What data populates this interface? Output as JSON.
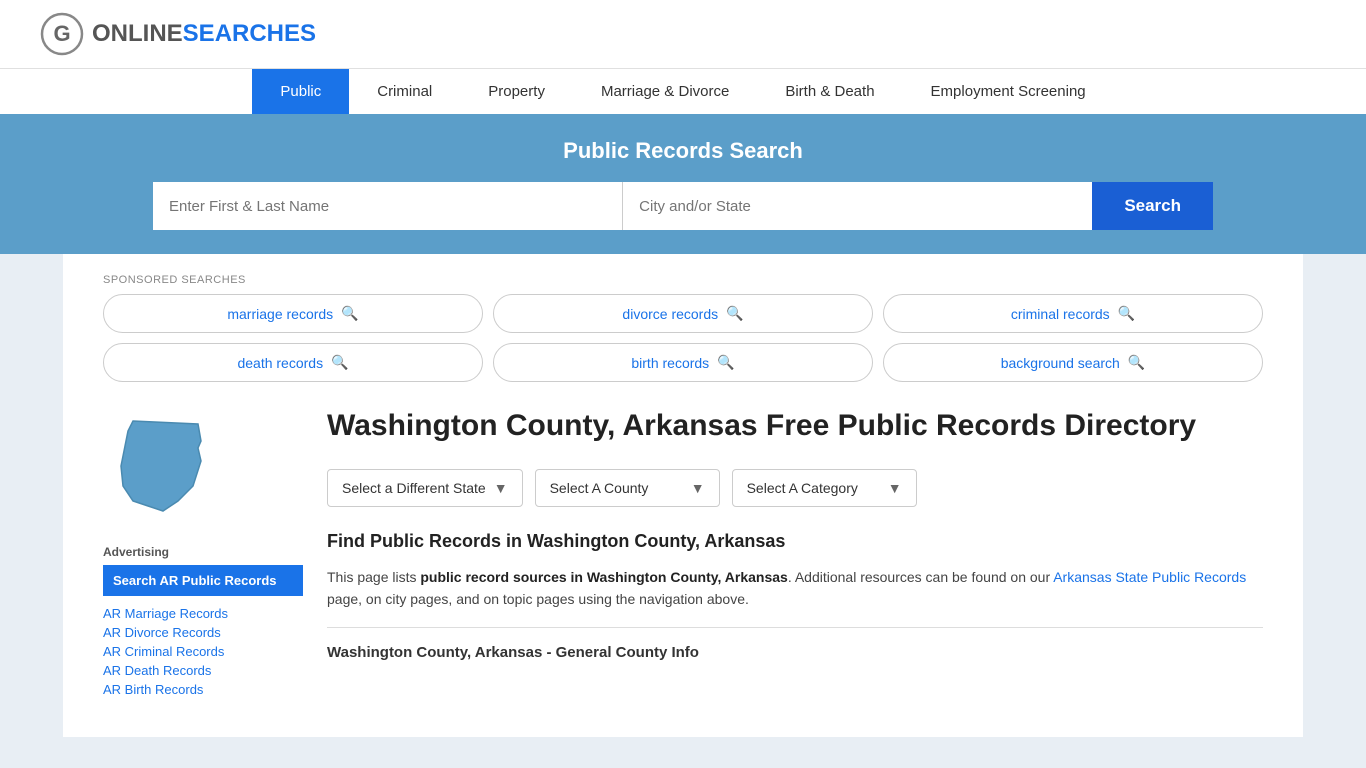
{
  "site": {
    "name_part1": "ONLINE",
    "name_part2": "SEARCHES"
  },
  "nav": {
    "items": [
      {
        "label": "Public",
        "active": true
      },
      {
        "label": "Criminal",
        "active": false
      },
      {
        "label": "Property",
        "active": false
      },
      {
        "label": "Marriage & Divorce",
        "active": false
      },
      {
        "label": "Birth & Death",
        "active": false
      },
      {
        "label": "Employment Screening",
        "active": false
      }
    ]
  },
  "search_banner": {
    "title": "Public Records Search",
    "name_placeholder": "Enter First & Last Name",
    "location_placeholder": "City and/or State",
    "button_label": "Search"
  },
  "sponsored": {
    "label": "SPONSORED SEARCHES",
    "items": [
      {
        "label": "marriage records"
      },
      {
        "label": "divorce records"
      },
      {
        "label": "criminal records"
      },
      {
        "label": "death records"
      },
      {
        "label": "birth records"
      },
      {
        "label": "background search"
      }
    ]
  },
  "dropdowns": {
    "state": "Select a Different State",
    "county": "Select A County",
    "category": "Select A Category"
  },
  "page": {
    "title": "Washington County, Arkansas Free Public Records Directory",
    "find_heading": "Find Public Records in Washington County, Arkansas",
    "description_part1": "This page lists ",
    "description_bold": "public record sources in Washington County, Arkansas",
    "description_part2": ". Additional resources can be found on our ",
    "description_link": "Arkansas State Public Records",
    "description_part3": " page, on city pages, and on topic pages using the navigation above.",
    "general_info_heading": "Washington County, Arkansas - General County Info"
  },
  "sidebar": {
    "advertising_label": "Advertising",
    "ad_box_text": "Search AR Public Records",
    "links": [
      {
        "label": "AR Marriage Records"
      },
      {
        "label": "AR Divorce Records"
      },
      {
        "label": "AR Criminal Records"
      },
      {
        "label": "AR Death Records"
      },
      {
        "label": "AR Birth Records"
      }
    ]
  }
}
